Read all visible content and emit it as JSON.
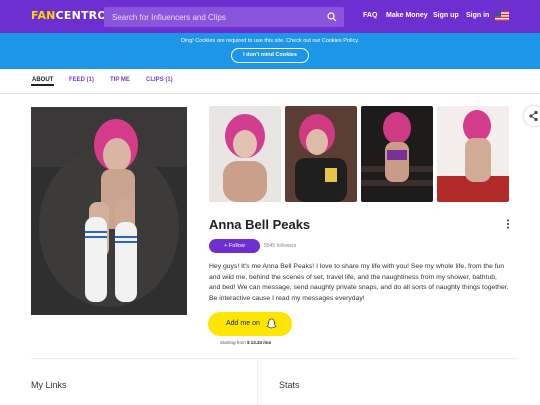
{
  "header": {
    "logo_part1": "FAN",
    "logo_part2": "CENTRO",
    "search_placeholder": "Search for Influencers and Clips",
    "nav": [
      "FAQ",
      "Make Money",
      "Sign up",
      "Sign in"
    ],
    "flag_icon": "us-flag-icon",
    "brand_color": "#6e2fd0"
  },
  "cookie_banner": {
    "text": "Ding! Cookies are required to use this site. Check out our Cookies Policy.",
    "button": "I don't mind Cookies",
    "color": "#1e96e8"
  },
  "tabs": [
    {
      "label": "ABOUT",
      "active": true
    },
    {
      "label": "FEED (1)",
      "active": false
    },
    {
      "label": "TIP ME",
      "active": false
    },
    {
      "label": "CLIPS (1)",
      "active": false
    }
  ],
  "profile": {
    "name": "Anna Bell Peaks",
    "follow_label": "+ Follow",
    "followers": "5545 followers",
    "bio": "Hey guys! It's me Anna Bell Peaks! I love to share my life with you! See my whole life, from the fun and wild me, behind the scenes of set, travel life, and the naughtiness from my shower, bathtub, and bed! We can message, send naughty private snaps, and do all sorts of naughty things together. Be interactive cause I read my messages everyday!",
    "snap_button": "Add me on",
    "snap_icon": "snapchat-ghost-icon",
    "starting_label": "Starting from",
    "starting_price": "$ 13.33 /mo"
  },
  "sections": {
    "links_title": "My Links",
    "stats_title": "Stats"
  }
}
